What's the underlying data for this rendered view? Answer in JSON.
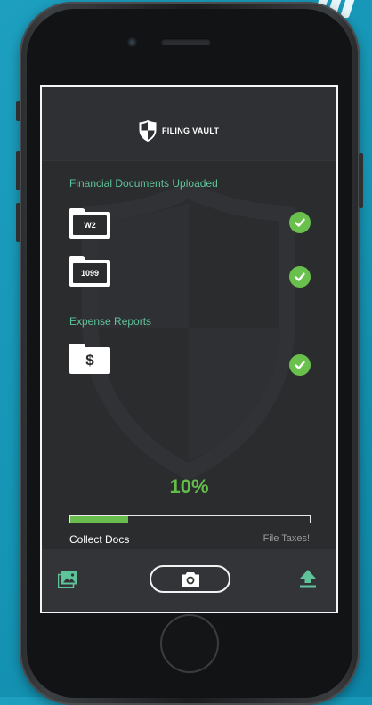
{
  "app": {
    "name": "FILING VAULT"
  },
  "sections": [
    {
      "label": "Financial Documents Uploaded",
      "items": [
        {
          "icon": "folder-icon",
          "label": "W2",
          "status": "uploaded"
        },
        {
          "icon": "folder-icon",
          "label": "1099",
          "status": "uploaded"
        }
      ]
    },
    {
      "label": "Expense Reports",
      "items": [
        {
          "icon": "folder-icon",
          "label": "$",
          "status": "uploaded"
        }
      ]
    }
  ],
  "progress": {
    "value_text": "10%",
    "fraction": 0.24,
    "start_label": "Collect Docs",
    "end_label": "File Taxes!"
  },
  "toolbar": {
    "gallery_icon": "image-gallery-icon",
    "camera_icon": "camera-icon",
    "upload_icon": "upload-icon"
  },
  "colors": {
    "accent_green": "#69c04d",
    "label_green": "#5fc39a",
    "screen_bg": "#2b2c2e",
    "background": "#1d9fbf"
  }
}
